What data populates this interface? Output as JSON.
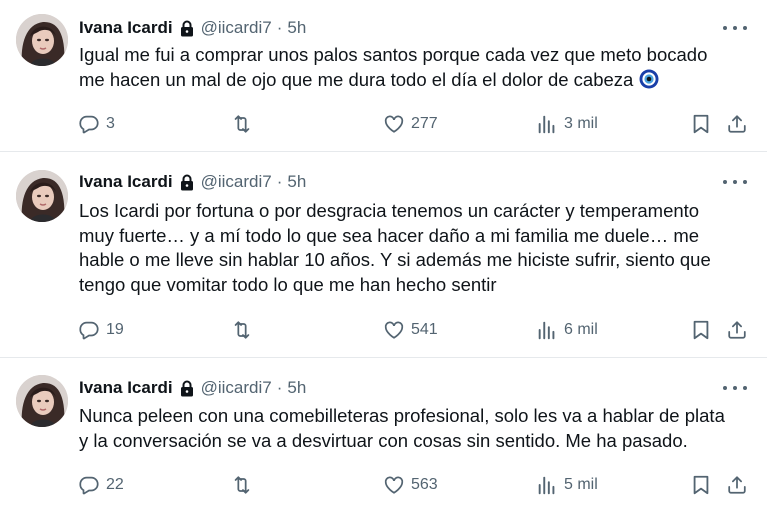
{
  "tweets": [
    {
      "author": {
        "name": "Ivana Icardi",
        "handle": "@iicardi7",
        "separator": "·",
        "time": "5h"
      },
      "lines": [
        "Igual me fui a comprar unos palos santos porque cada vez que meto bocado",
        "me hacen un mal de ojo que me dura todo el día el dolor de cabeza"
      ],
      "emoji": "nazar-amulet",
      "metrics": {
        "replies": "3",
        "retweets": "",
        "likes": "277",
        "views": "3 mil"
      }
    },
    {
      "author": {
        "name": "Ivana Icardi",
        "handle": "@iicardi7",
        "separator": "·",
        "time": "5h"
      },
      "lines": [
        "Los Icardi por fortuna o por desgracia tenemos un carácter y temperamento",
        "muy fuerte… y a mí todo lo que sea hacer daño a mi familia me duele… me",
        "hable o me lleve sin hablar 10 años. Y si además me hiciste sufrir, siento que",
        "tengo que vomitar todo lo que me han hecho sentir"
      ],
      "metrics": {
        "replies": "19",
        "retweets": "",
        "likes": "541",
        "views": "6 mil"
      }
    },
    {
      "author": {
        "name": "Ivana Icardi",
        "handle": "@iicardi7",
        "separator": "·",
        "time": "5h"
      },
      "lines": [
        "Nunca peleen con una comebilleteras profesional, solo les va a hablar de plata",
        "y la conversación se va a desvirtuar con cosas sin sentido. Me ha pasado."
      ],
      "metrics": {
        "replies": "22",
        "retweets": "",
        "likes": "563",
        "views": "5 mil"
      }
    }
  ],
  "icons": {
    "lock": "lock-icon",
    "more": "more-icon",
    "reply": "reply-icon",
    "retweet": "retweet-icon",
    "like": "heart-icon",
    "views": "views-icon",
    "bookmark": "bookmark-icon",
    "share": "share-icon"
  },
  "colors": {
    "text": "#0f1419",
    "secondary": "#536471",
    "divider": "#e6e9ec",
    "nazar_blue": "#1a3fa8"
  }
}
